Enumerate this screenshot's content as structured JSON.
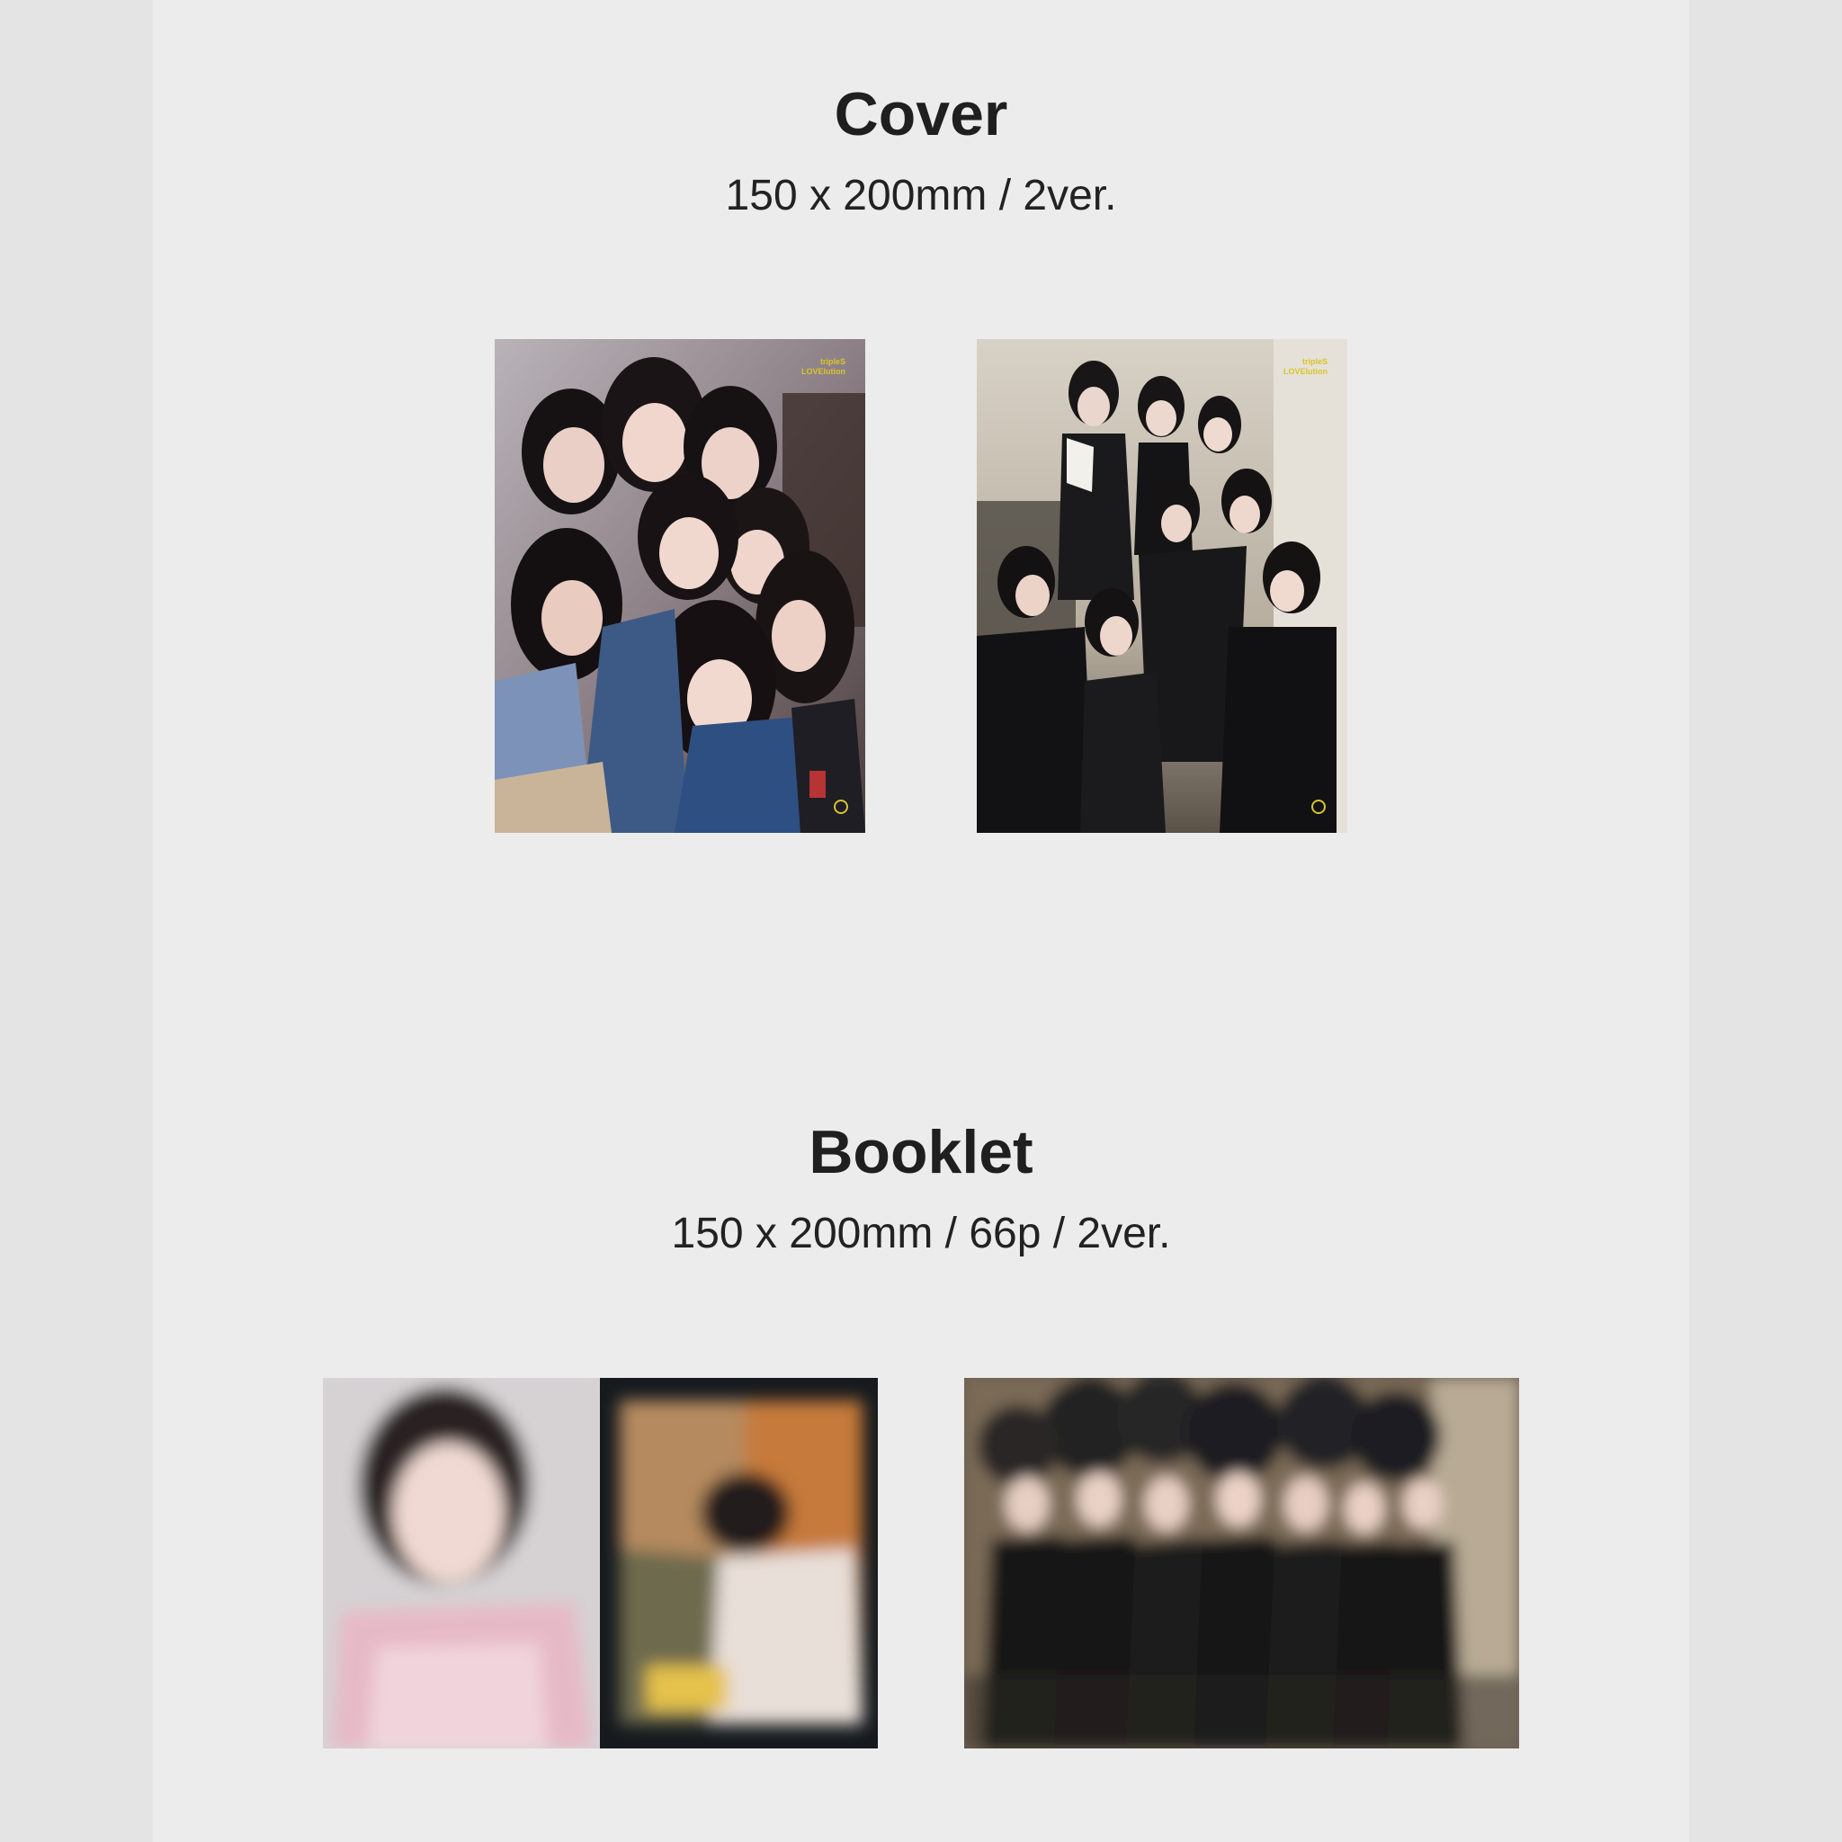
{
  "sections": [
    {
      "title": "Cover",
      "spec": "150 x 200mm / 2ver."
    },
    {
      "title": "Booklet",
      "spec": "150 x 200mm / 66p / 2ver."
    }
  ],
  "cover_images": [
    {
      "name": "cover-version-1-image",
      "label_line1": "tripleS",
      "label_line2": "LOVElution"
    },
    {
      "name": "cover-version-2-image",
      "label_line1": "tripleS",
      "label_line2": "LOVElution"
    }
  ],
  "booklet_images": [
    {
      "name": "booklet-version-1-spread"
    },
    {
      "name": "booklet-version-2-spread"
    }
  ],
  "colors": {
    "background": "#ebebeb",
    "text": "#1f1f1f",
    "cover_label": "#d9c42a"
  }
}
